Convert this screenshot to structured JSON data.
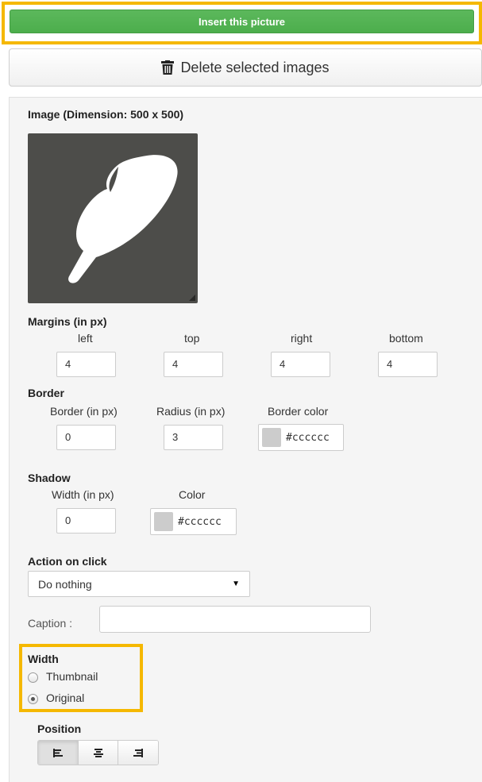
{
  "actions": {
    "insert_label": "Insert this picture",
    "delete_label": "Delete selected images",
    "insert_color": "#5cb85c",
    "highlight_color": "#f5b800"
  },
  "image": {
    "heading": "Image (Dimension: 500 x 500)",
    "icon": "feather-icon",
    "background": "#4d4d4a"
  },
  "margins": {
    "heading": "Margins (in px)",
    "fields": [
      {
        "label": "left",
        "value": "4"
      },
      {
        "label": "top",
        "value": "4"
      },
      {
        "label": "right",
        "value": "4"
      },
      {
        "label": "bottom",
        "value": "4"
      }
    ]
  },
  "border": {
    "heading": "Border",
    "width_label": "Border (in px)",
    "width_value": "0",
    "radius_label": "Radius (in px)",
    "radius_value": "3",
    "color_label": "Border color",
    "color_value": "#cccccc"
  },
  "shadow": {
    "heading": "Shadow",
    "width_label": "Width (in px)",
    "width_value": "0",
    "color_label": "Color",
    "color_value": "#cccccc"
  },
  "action_on_click": {
    "heading": "Action on click",
    "selected": "Do nothing"
  },
  "caption": {
    "label": "Caption :",
    "value": ""
  },
  "width": {
    "heading": "Width",
    "options": [
      {
        "label": "Thumbnail",
        "checked": false
      },
      {
        "label": "Original",
        "checked": true
      }
    ]
  },
  "position": {
    "heading": "Position",
    "buttons": [
      "align-left-icon",
      "align-center-icon",
      "align-right-icon"
    ],
    "active": "align-left-icon"
  }
}
